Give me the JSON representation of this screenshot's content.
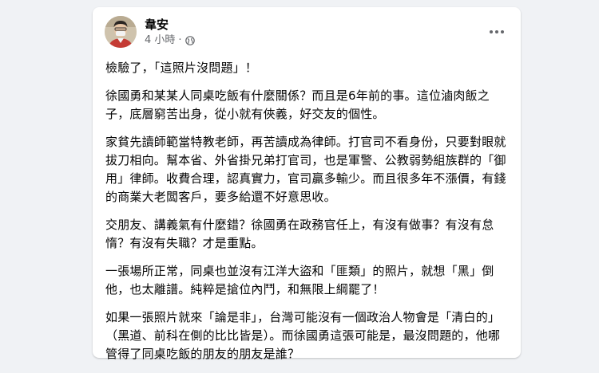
{
  "post": {
    "author": "韋安",
    "time": "4 小時",
    "separator": "·",
    "privacy_icon": "globe-icon",
    "more_icon": "more-options-icon",
    "paragraphs": [
      "檢驗了，「這照片沒問題」！",
      "徐國勇和某某人同桌吃飯有什麼關係？而且是6年前的事。這位滷肉飯之子，底層窮苦出身，從小就有俠義，好交友的個性。",
      "家貧先讀師範當特教老師，再苦讀成為律師。打官司不看身份，只要對眼就拔刀相向。幫本省、外省掛兄弟打官司，也是軍警、公教弱勢組族群的「御用」律師。收費合理，認真實力，官司贏多輸少。而且很多年不漲價，有錢的商業大老闆客戶，要多給還不好意思收。",
      "交朋友、講義氣有什麼錯？徐國勇在政務官任上，有沒有做事？有沒有怠惰？有沒有失職？才是重點。",
      "一張場所正常，同桌也並沒有江洋大盜和「匪類」的照片，就想「黑」倒他，也太離譜。純粹是搶位內鬥，和無限上綱罷了！",
      "如果一張照片就來「論是非」，台灣可能沒有一個政治人物會是「清白的」（黑道、前科在側的比比皆是）。而徐國勇這張可能是，最沒問題的，他哪管得了同桌吃飯的朋友的朋友是誰？"
    ]
  }
}
